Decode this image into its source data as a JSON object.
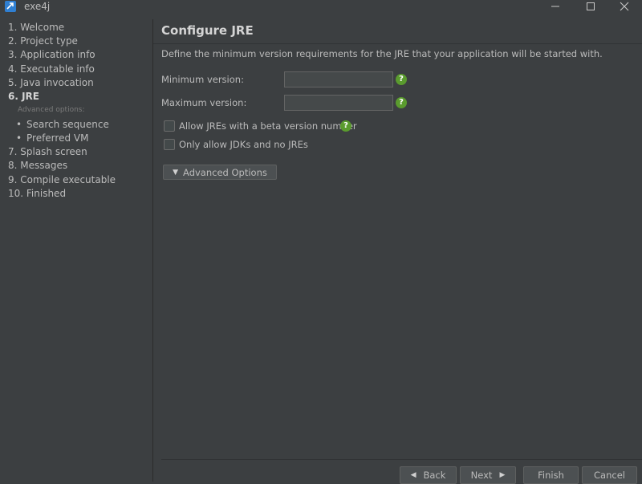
{
  "window": {
    "title": "exe4j",
    "controls": [
      "minimize",
      "maximize",
      "close"
    ]
  },
  "sidebar": {
    "items": [
      {
        "label": "1. Welcome"
      },
      {
        "label": "2. Project type"
      },
      {
        "label": "3. Application info"
      },
      {
        "label": "4. Executable info"
      },
      {
        "label": "5. Java invocation"
      },
      {
        "label": "6. JRE",
        "active": true
      },
      {
        "label": "7. Splash screen"
      },
      {
        "label": "8. Messages"
      },
      {
        "label": "9. Compile executable"
      },
      {
        "label": "10. Finished"
      }
    ],
    "advanced_heading": "Advanced options:",
    "advanced_items": [
      {
        "label": "Search sequence"
      },
      {
        "label": "Preferred VM"
      }
    ]
  },
  "main": {
    "title": "Configure JRE",
    "description": "Define the minimum version requirements for the JRE that your application will be started with.",
    "fields": {
      "min_version": {
        "label": "Minimum version:",
        "value": ""
      },
      "max_version": {
        "label": "Maximum version:",
        "value": ""
      }
    },
    "checkboxes": {
      "allow_beta": {
        "label": "Allow JREs with a beta version number",
        "checked": false
      },
      "only_jdks": {
        "label": "Only allow JDKs and no JREs",
        "checked": false
      }
    },
    "advanced_button": "Advanced Options",
    "help_glyph": "?"
  },
  "footer": {
    "back": "Back",
    "next": "Next",
    "finish": "Finish",
    "cancel": "Cancel"
  },
  "colors": {
    "background": "#3c3f41",
    "help_icon": "#5a9b2e",
    "app_icon": "#2f7fd2"
  }
}
